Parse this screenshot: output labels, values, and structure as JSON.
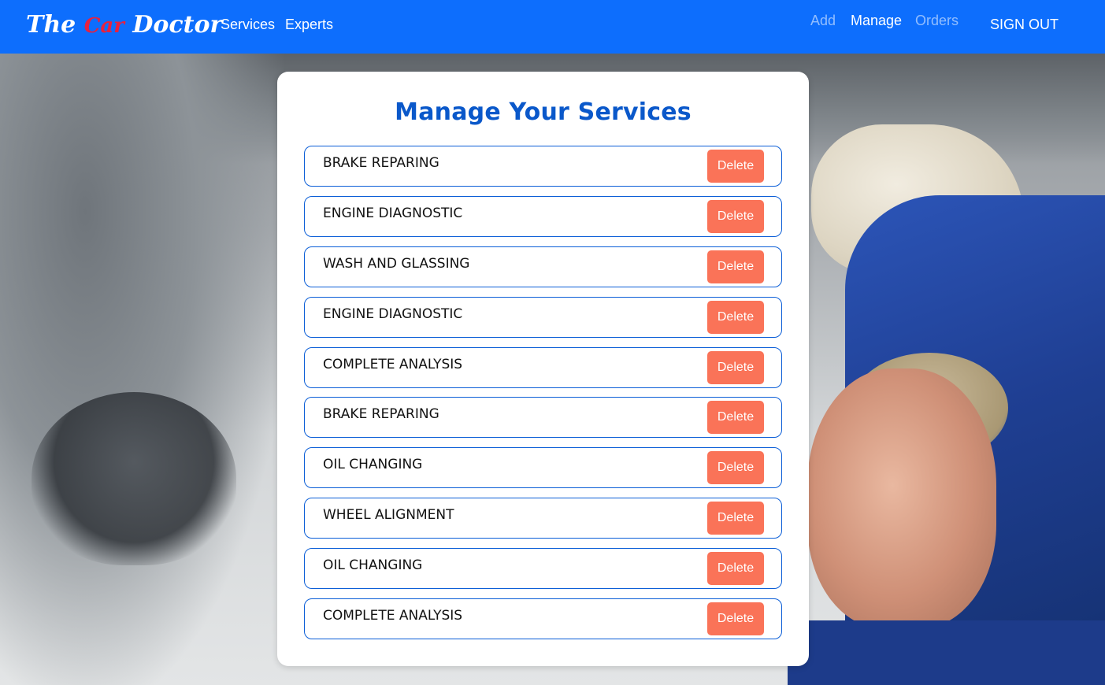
{
  "navbar": {
    "brand": {
      "word1": "The",
      "word2": "Car",
      "word3": "Doctor"
    },
    "links": {
      "services": "Services",
      "experts": "Experts"
    },
    "right": {
      "add": "Add",
      "manage": "Manage",
      "orders": "Orders",
      "sign_out": "SIGN OUT"
    }
  },
  "main": {
    "title": "Manage Your Services",
    "delete_label": "Delete",
    "services": [
      "BRAKE REPARING",
      "ENGINE DIAGNOSTIC",
      "WASH AND GLASSING",
      "ENGINE DIAGNOSTIC",
      "COMPLETE ANALYSIS",
      "BRAKE REPARING",
      "OIL CHANGING",
      "WHEEL ALIGNMENT",
      "OIL CHANGING",
      "COMPLETE ANALYSIS"
    ]
  },
  "colors": {
    "navbar": "#0d6efd",
    "title": "#0a58ca",
    "row_border": "#0b5ed7",
    "delete_button": "#fa7358",
    "brand_accent": "#e8213f"
  }
}
